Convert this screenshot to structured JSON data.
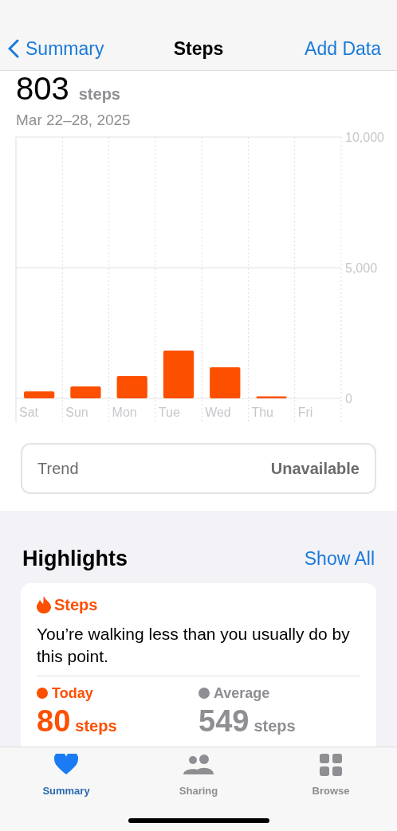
{
  "nav": {
    "back": "Summary",
    "title": "Steps",
    "action": "Add Data"
  },
  "summary": {
    "value": "803",
    "unit": "steps",
    "range": "Mar 22–28, 2025"
  },
  "chart_data": {
    "type": "bar",
    "categories": [
      "Sat",
      "Sun",
      "Mon",
      "Tue",
      "Wed",
      "Thu",
      "Fri"
    ],
    "series": [
      {
        "color": "#fc4f00",
        "values": [
          270,
          460,
          850,
          1830,
          1190,
          80,
          null
        ]
      }
    ],
    "ylim": [
      0,
      10000
    ],
    "yticks": [
      {
        "value": 0,
        "label": "0"
      },
      {
        "value": 5000,
        "label": "5,000"
      },
      {
        "value": 10000,
        "label": "10,000"
      }
    ]
  },
  "trend": {
    "label": "Trend",
    "value": "Unavailable"
  },
  "highlights": {
    "title": "Highlights",
    "action": "Show All",
    "card": {
      "category": "Steps",
      "message": "You’re walking less than you usually do by this point.",
      "stats": [
        {
          "label": "Today",
          "value": "80",
          "unit": "steps",
          "color": "#fc4f00"
        },
        {
          "label": "Average",
          "value": "549",
          "unit": "steps",
          "color": "#8e8e93"
        }
      ]
    }
  },
  "tabs": [
    {
      "label": "Summary",
      "selected": true
    },
    {
      "label": "Sharing",
      "selected": false
    },
    {
      "label": "Browse",
      "selected": false
    }
  ]
}
